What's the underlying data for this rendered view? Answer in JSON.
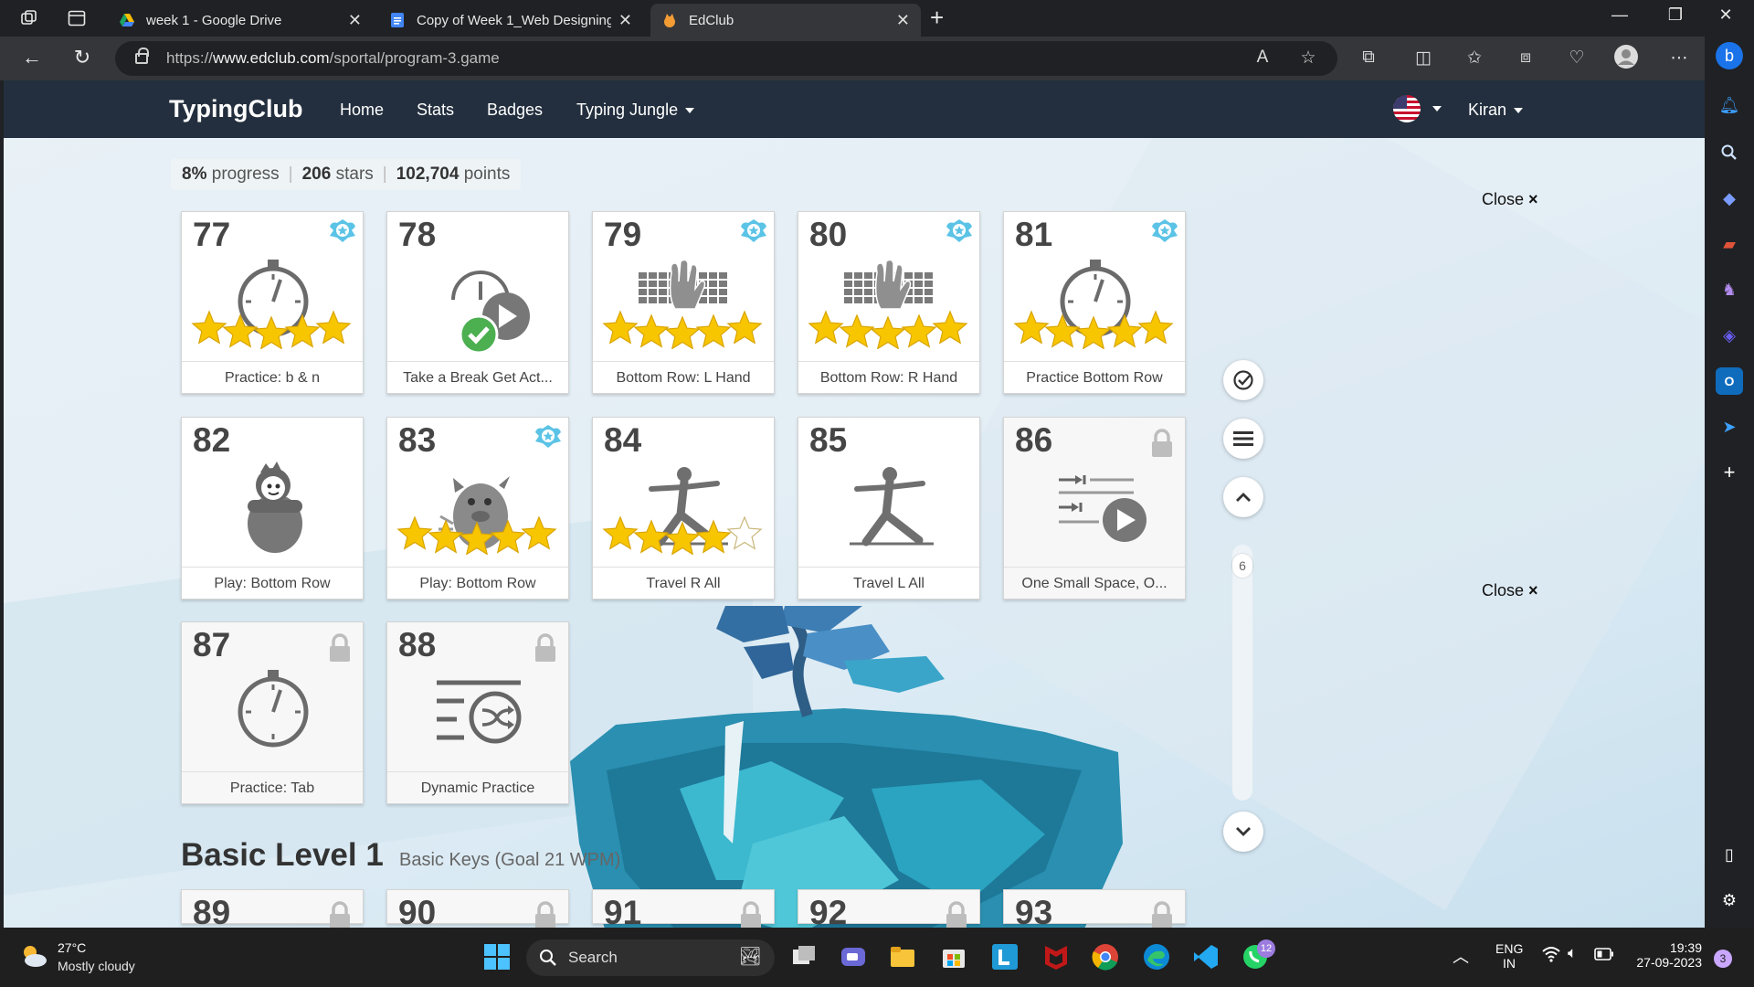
{
  "browser": {
    "tabs": [
      {
        "title": "week 1 - Google Drive",
        "active": false
      },
      {
        "title": "Copy of Week 1_Web Designing",
        "active": false
      },
      {
        "title": "EdClub",
        "active": true
      }
    ],
    "url_prefix": "https://",
    "url_domain": "www.edclub.com",
    "url_path": "/sportal/program-3.game"
  },
  "appnav": {
    "brand": "TypingClub",
    "links": [
      "Home",
      "Stats",
      "Badges",
      "Typing Jungle"
    ],
    "user": "Kiran"
  },
  "stats": {
    "progress_value": "8%",
    "progress_label": "progress",
    "stars_value": "206",
    "stars_label": "stars",
    "points_value": "102,704",
    "points_label": "points"
  },
  "close_label": "Close",
  "close_symbol": "×",
  "lessons": [
    {
      "num": "77",
      "label": "Practice: b & n",
      "stars": 5,
      "badge": true,
      "locked": false,
      "icon": "stopwatch-icon"
    },
    {
      "num": "78",
      "label": "Take a Break Get Act...",
      "stars": 0,
      "badge": false,
      "locked": false,
      "icon": "break-video-icon"
    },
    {
      "num": "79",
      "label": "Bottom Row: L Hand",
      "stars": 5,
      "badge": true,
      "locked": false,
      "icon": "keyboard-hand-icon"
    },
    {
      "num": "80",
      "label": "Bottom Row: R Hand",
      "stars": 5,
      "badge": true,
      "locked": false,
      "icon": "keyboard-hand-icon"
    },
    {
      "num": "81",
      "label": "Practice Bottom Row",
      "stars": 5,
      "badge": true,
      "locked": false,
      "icon": "stopwatch-icon"
    },
    {
      "num": "82",
      "label": "Play: Bottom Row",
      "stars": 0,
      "badge": false,
      "locked": false,
      "icon": "game-character-icon"
    },
    {
      "num": "83",
      "label": "Play: Bottom Row",
      "stars": 5,
      "badge": true,
      "locked": false,
      "icon": "game-monster-icon"
    },
    {
      "num": "84",
      "label": "Travel R All",
      "stars": 4,
      "badge": false,
      "locked": false,
      "icon": "yoga-pose-icon"
    },
    {
      "num": "85",
      "label": "Travel L All",
      "stars": 0,
      "badge": false,
      "locked": false,
      "icon": "yoga-pose-icon"
    },
    {
      "num": "86",
      "label": "One Small Space, O...",
      "stars": 0,
      "badge": false,
      "locked": true,
      "icon": "space-video-icon"
    },
    {
      "num": "87",
      "label": "Practice: Tab",
      "stars": 0,
      "badge": false,
      "locked": true,
      "icon": "stopwatch-icon"
    },
    {
      "num": "88",
      "label": "Dynamic Practice",
      "stars": 0,
      "badge": false,
      "locked": true,
      "icon": "dynamic-practice-icon"
    }
  ],
  "level": {
    "title": "Basic Level 1",
    "subtitle": "Basic Keys (Goal 21 WPM)",
    "next_lessons": [
      "89",
      "90",
      "91",
      "92",
      "93"
    ]
  },
  "scroll_indicator": "6",
  "taskbar": {
    "weather_temp": "27°C",
    "weather_desc": "Mostly cloudy",
    "search_placeholder": "Search",
    "whatsapp_badge": "12",
    "lang_top": "ENG",
    "lang_bottom": "IN",
    "time": "19:39",
    "date": "27-09-2023",
    "notif_count": "3"
  },
  "colors": {
    "nav_bg": "#232f3e",
    "star": "#f7c600",
    "badge": "#5bc3e6",
    "check": "#4caf50"
  }
}
